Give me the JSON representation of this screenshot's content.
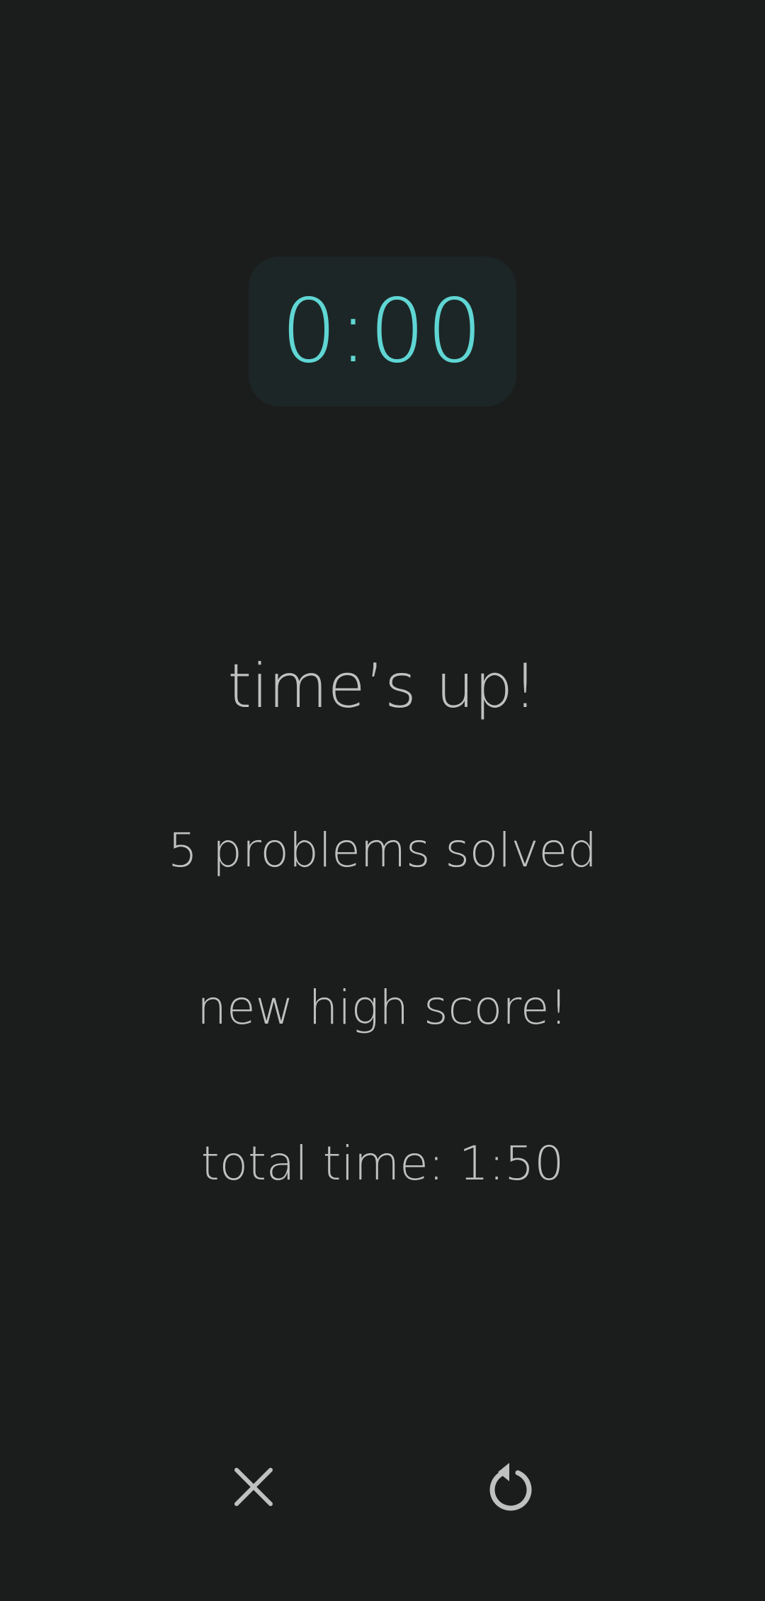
{
  "timer": {
    "display": "0:00"
  },
  "result": {
    "title": "time’s up!",
    "problems_solved": "5 problems solved",
    "high_score": "new high score!",
    "total_time": "total time: 1:50"
  },
  "actions": {
    "close_icon": "close-icon",
    "restart_icon": "restart-icon"
  },
  "colors": {
    "background": "#1b1c1c",
    "timer_background": "#1d2626",
    "timer_text": "#5fd6d4",
    "text": "#bfc1c1"
  }
}
